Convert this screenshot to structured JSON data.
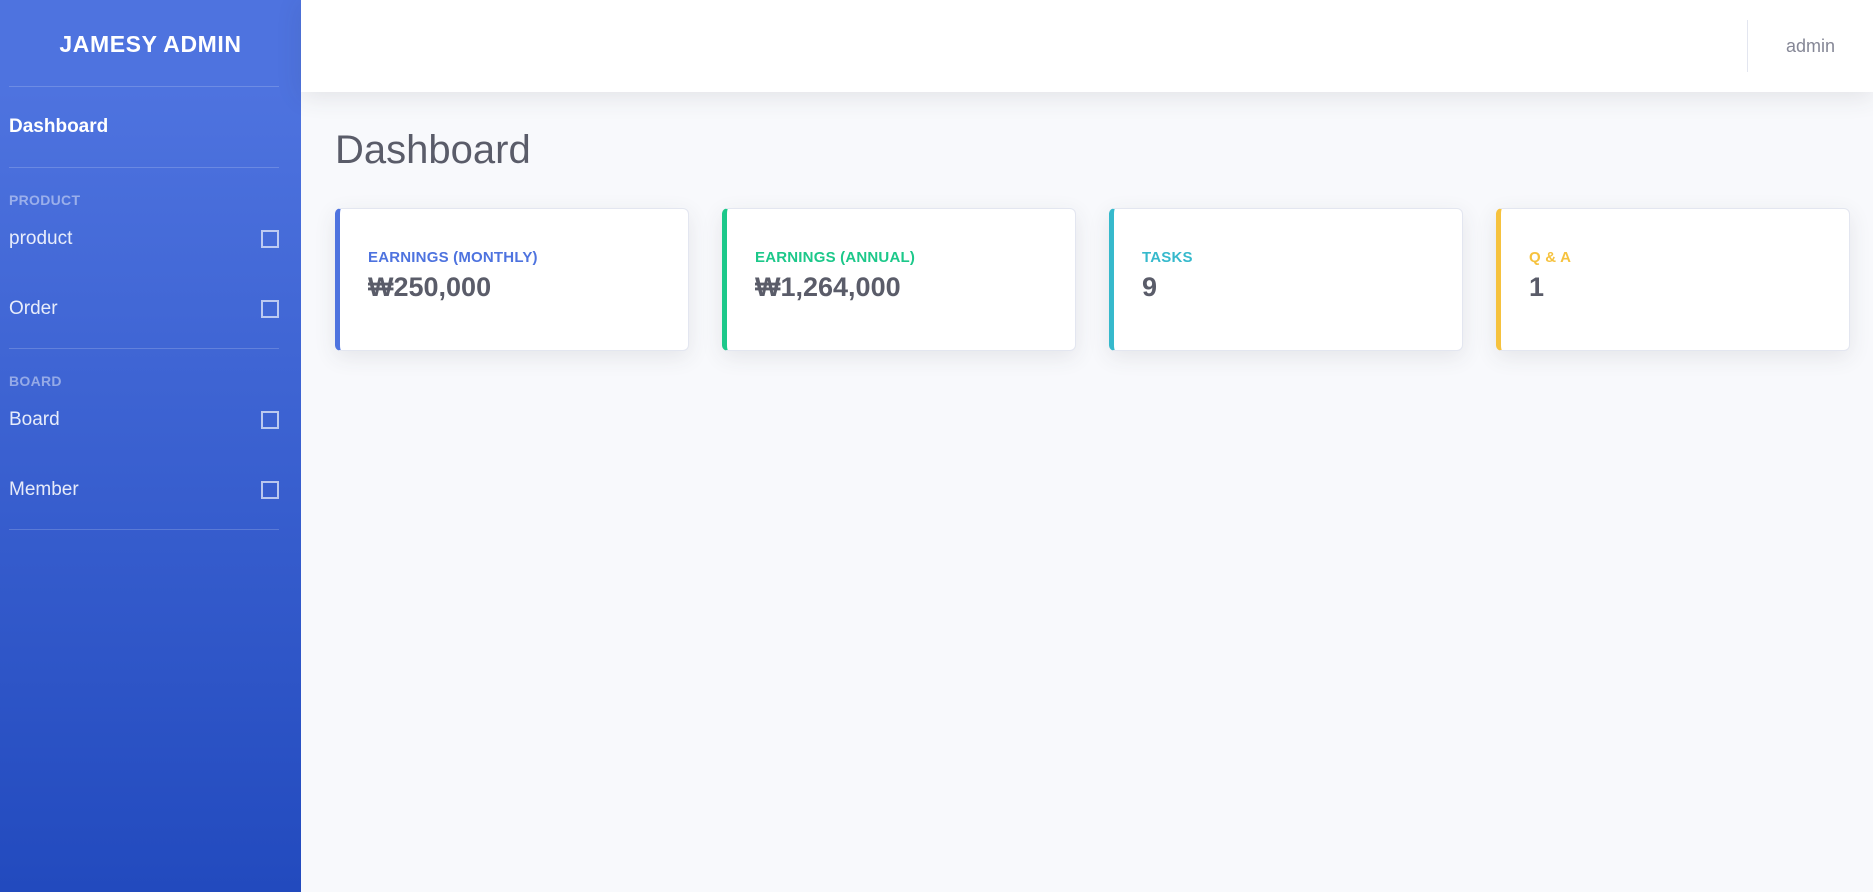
{
  "sidebar": {
    "brand": "JAMESY ADMIN",
    "dashboard_label": "Dashboard",
    "sections": [
      {
        "heading": "PRODUCT",
        "items": [
          {
            "label": "product"
          },
          {
            "label": "Order"
          }
        ]
      },
      {
        "heading": "BOARD",
        "items": [
          {
            "label": "Board"
          },
          {
            "label": "Member"
          }
        ]
      }
    ]
  },
  "topbar": {
    "user": "admin"
  },
  "main": {
    "title": "Dashboard",
    "cards": [
      {
        "label": "EARNINGS (MONTHLY)",
        "value": "₩250,000",
        "color": "#4e73df"
      },
      {
        "label": "EARNINGS (ANNUAL)",
        "value": "₩1,264,000",
        "color": "#1cc88a"
      },
      {
        "label": "TASKS",
        "value": "9",
        "color": "#36b9cc"
      },
      {
        "label": "Q & A",
        "value": "1",
        "color": "#f6c23e"
      }
    ]
  }
}
